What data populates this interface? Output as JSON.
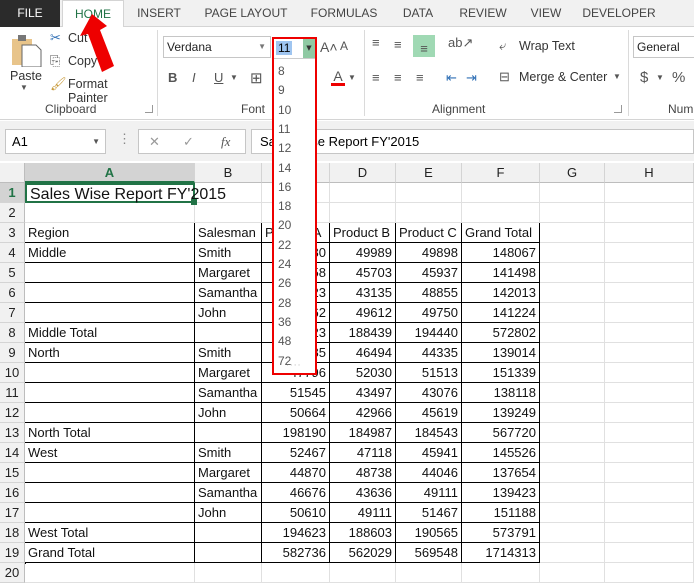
{
  "tabs": [
    "FILE",
    "HOME",
    "INSERT",
    "PAGE LAYOUT",
    "FORMULAS",
    "DATA",
    "REVIEW",
    "VIEW",
    "DEVELOPER"
  ],
  "active_tab": "HOME",
  "clipboard": {
    "paste": "Paste",
    "cut": "Cut",
    "copy": "Copy",
    "format_painter": "Format Painter",
    "label": "Clipboard"
  },
  "font": {
    "name": "Verdana",
    "size": "11",
    "label": "Font",
    "bold": "B",
    "italic": "I",
    "underline": "U"
  },
  "font_size_options": [
    "8",
    "9",
    "10",
    "11",
    "12",
    "14",
    "16",
    "18",
    "20",
    "22",
    "24",
    "26",
    "28",
    "36",
    "48",
    "72"
  ],
  "alignment": {
    "wrap_text": "Wrap Text",
    "merge_center": "Merge & Center",
    "label": "Alignment"
  },
  "number": {
    "format": "General",
    "currency": "$",
    "percent": "%",
    "label": "Num"
  },
  "formula_bar": {
    "name_box": "A1",
    "cancel": "✕",
    "enter": "✓",
    "fx": "fx",
    "formula": "Sales Wise Report FY'2015"
  },
  "columns": [
    "A",
    "B",
    "C",
    "D",
    "E",
    "F",
    "G",
    "H"
  ],
  "rows": [
    "1",
    "2",
    "3",
    "4",
    "5",
    "6",
    "7",
    "8",
    "9",
    "10",
    "11",
    "12",
    "13",
    "14",
    "15",
    "16",
    "17",
    "18",
    "19",
    "20"
  ],
  "sheet": {
    "title": "Sales Wise Report FY'2015",
    "headers": [
      "Region",
      "Salesman",
      "Product A",
      "Product B",
      "Product C",
      "Grand Total"
    ],
    "data": [
      [
        "Middle",
        "Smith",
        "48180",
        "49989",
        "49898",
        "148067"
      ],
      [
        "",
        "Margaret",
        "49858",
        "45703",
        "45937",
        "141498"
      ],
      [
        "",
        "Samantha",
        "50023",
        "43135",
        "48855",
        "142013"
      ],
      [
        "",
        "John",
        "41862",
        "49612",
        "49750",
        "141224"
      ],
      [
        "Middle Total",
        "",
        "189923",
        "188439",
        "194440",
        "572802"
      ],
      [
        "North",
        "Smith",
        "48185",
        "46494",
        "44335",
        "139014"
      ],
      [
        "",
        "Margaret",
        "47796",
        "52030",
        "51513",
        "151339"
      ],
      [
        "",
        "Samantha",
        "51545",
        "43497",
        "43076",
        "138118"
      ],
      [
        "",
        "John",
        "50664",
        "42966",
        "45619",
        "139249"
      ],
      [
        "North Total",
        "",
        "198190",
        "184987",
        "184543",
        "567720"
      ],
      [
        "West",
        "Smith",
        "52467",
        "47118",
        "45941",
        "145526"
      ],
      [
        "",
        "Margaret",
        "44870",
        "48738",
        "44046",
        "137654"
      ],
      [
        "",
        "Samantha",
        "46676",
        "43636",
        "49111",
        "139423"
      ],
      [
        "",
        "John",
        "50610",
        "49111",
        "51467",
        "151188"
      ],
      [
        "West Total",
        "",
        "194623",
        "188603",
        "190565",
        "573791"
      ],
      [
        "Grand Total",
        "",
        "582736",
        "562029",
        "569548",
        "1714313"
      ]
    ]
  },
  "colors": {
    "accent": "#217346",
    "highlight_box": "#ee0000",
    "arrow": "#ee0000"
  }
}
